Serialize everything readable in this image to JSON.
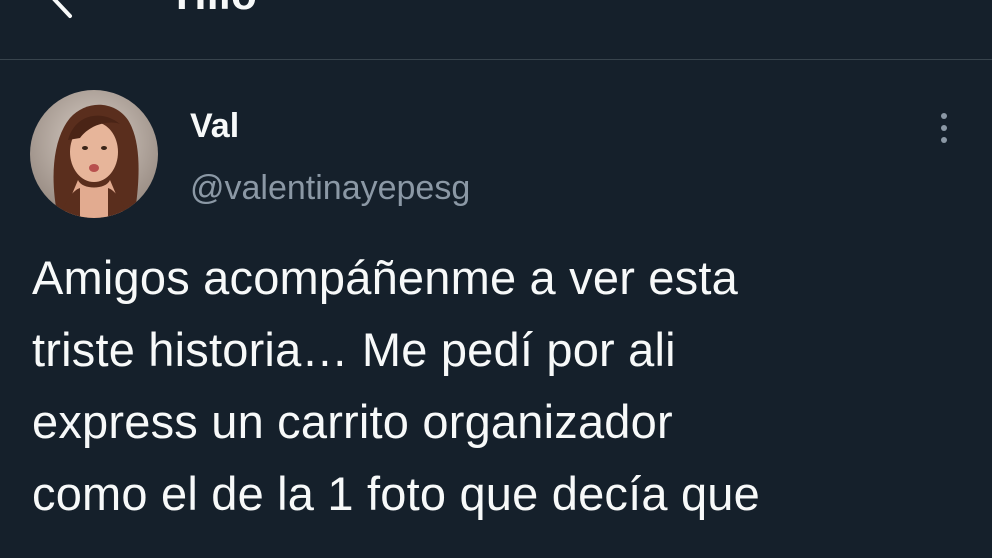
{
  "header": {
    "title": "Hilo",
    "back_icon": "arrow-left-icon"
  },
  "tweet": {
    "author_name": "Val",
    "author_handle": "@valentinayepesg",
    "more_icon": "more-vertical-icon",
    "text": "Amigos acompáñenme a ver esta\ntriste historia… Me pedí por ali\nexpress un carrito organizador\ncomo el de la 1 foto que decía que"
  },
  "colors": {
    "background": "#15202b",
    "primary_text": "#f7f9f9",
    "secondary_text": "#8b98a5",
    "divider": "#38444d"
  }
}
